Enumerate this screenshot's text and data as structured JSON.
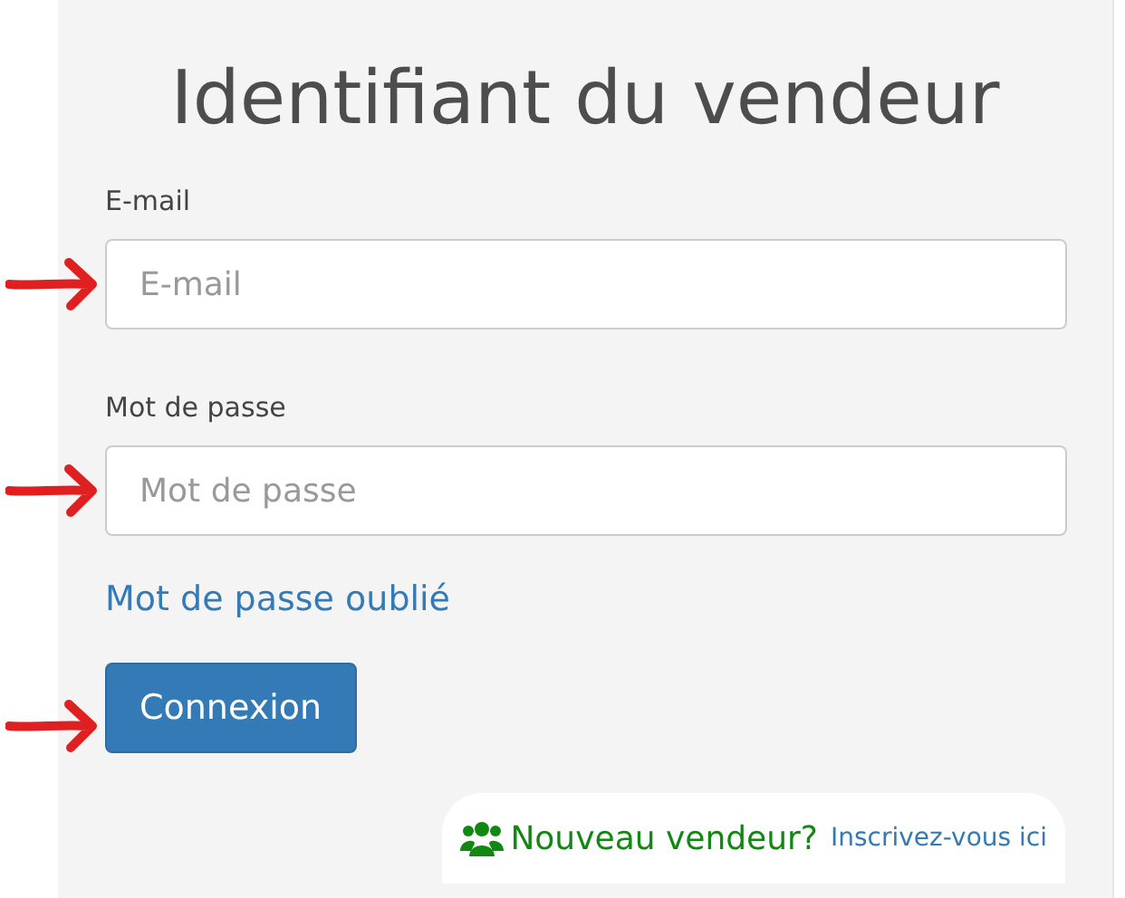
{
  "title": "Identifiant du vendeur",
  "fields": [
    {
      "label": "E-mail",
      "placeholder": "E-mail"
    },
    {
      "label": "Mot de passe",
      "placeholder": "Mot de passe"
    }
  ],
  "forgot_link": "Mot de passe oublié",
  "submit_button": "Connexion",
  "signup": {
    "prompt": "Nouveau vendeur?",
    "link": "Inscrivez-vous ici"
  }
}
